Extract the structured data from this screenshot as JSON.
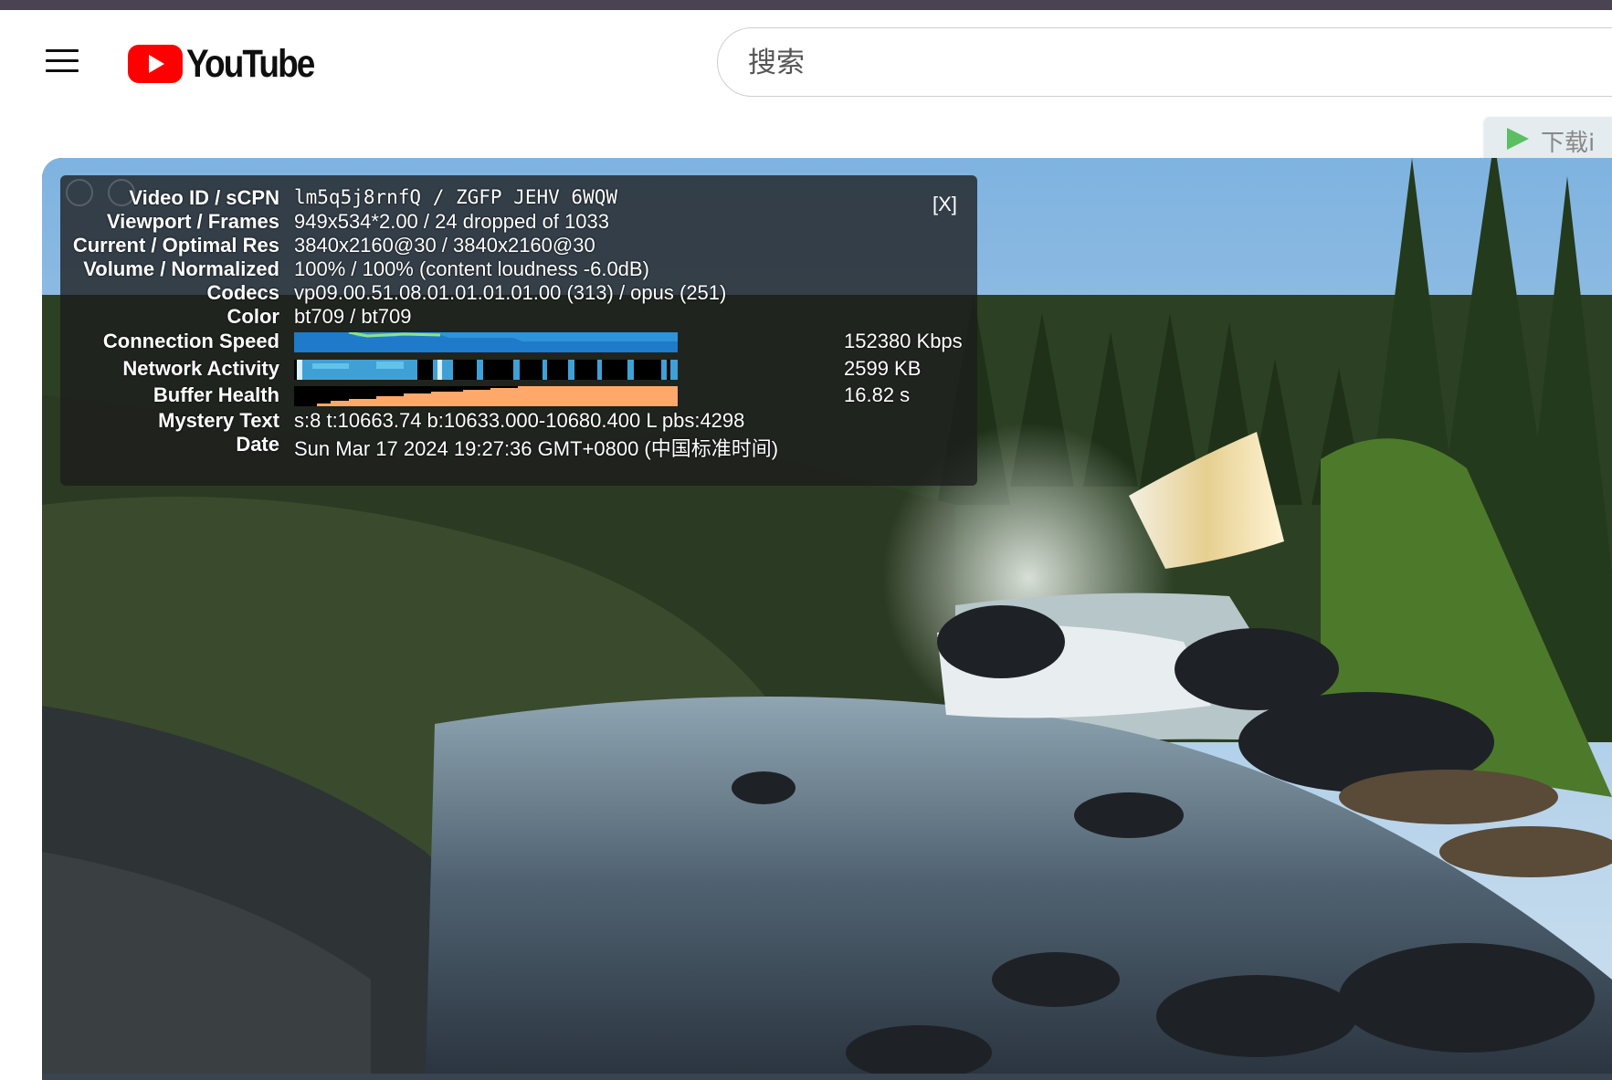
{
  "app": {
    "name": "YouTube"
  },
  "header": {
    "search_placeholder": "搜索",
    "download_badge": "下载i"
  },
  "stats": {
    "close_label": "[X]",
    "rows": [
      {
        "label": "Video ID / sCPN",
        "value": "lm5q5j8rnfQ / ZGFP JEHV 6WQW"
      },
      {
        "label": "Viewport / Frames",
        "value": "949x534*2.00 / 24 dropped of 1033"
      },
      {
        "label": "Current / Optimal Res",
        "value": "3840x2160@30 / 3840x2160@30"
      },
      {
        "label": "Volume / Normalized",
        "value": "100% / 100% (content loudness -6.0dB)"
      },
      {
        "label": "Codecs",
        "value": "vp09.00.51.08.01.01.01.01.00 (313) / opus (251)"
      },
      {
        "label": "Color",
        "value": "bt709 / bt709"
      },
      {
        "label": "Connection Speed",
        "value": "152380 Kbps"
      },
      {
        "label": "Network Activity",
        "value": "2599 KB"
      },
      {
        "label": "Buffer Health",
        "value": "16.82 s"
      },
      {
        "label": "Mystery Text",
        "value": "s:8 t:10663.74 b:10633.000-10680.400 L pbs:4298"
      },
      {
        "label": "Date",
        "value": "Sun Mar 17 2024 19:27:36 GMT+0800 (中国标准时间)"
      }
    ]
  },
  "colors": {
    "connection_bar": "#1f7ac9",
    "network_bar": "#3fa0d6",
    "buffer_bar": "#ffa86b",
    "logo_red": "#ff0000"
  }
}
